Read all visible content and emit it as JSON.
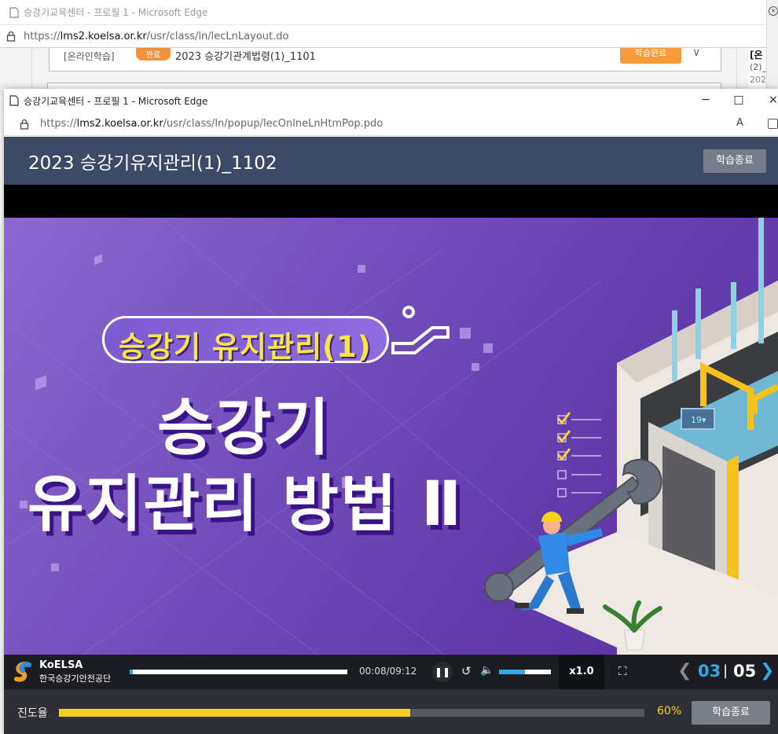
{
  "background_window": {
    "title": "승강기교육센터 - 프로필 1 - Microsoft Edge",
    "url_prefix": "https://",
    "url_host": "lms2.koelsa.or.kr",
    "url_path": "/usr/class/ln/lecLnLayout.do",
    "row": {
      "category": "[온라인학습]",
      "badge": "완료",
      "course": "2023 승강기관계법령(1)_1101",
      "button": "학습완료"
    },
    "side": {
      "line1": "[온",
      "line2": "(2)_",
      "line3": "202"
    }
  },
  "popup": {
    "title": "승강기교육센터 - 프로필 1 - Microsoft Edge",
    "url_prefix": "https://",
    "url_host": "lms2.koelsa.or.kr",
    "url_path": "/usr/class/ln/popup/lecOnlneLnHtmPop.pdo",
    "reader_label": "A",
    "lecture_title": "2023 승강기유지관리(1)_1102",
    "end_button": "학습종료"
  },
  "video": {
    "pill_title": "승강기 유지관리(1)",
    "headline_1": "승강기",
    "headline_2": "유지관리 방법 Ⅱ"
  },
  "controls": {
    "brand_en": "KoELSA",
    "brand_ko": "한국승강기안전공단",
    "time": "00:08/09:12",
    "seek_fraction": 0.014,
    "volume_fraction": 0.5,
    "speed": "x1.0",
    "current_page": "03",
    "separator": "|",
    "total_pages": "05"
  },
  "progress": {
    "label": "진도율",
    "percent_text": "60%",
    "percent": 60,
    "end_button": "학습종료"
  },
  "colors": {
    "header_bg": "#3d4a66",
    "accent_blue": "#2fa8e6",
    "progress_yellow": "#f2d21c",
    "orange": "#f89a3a"
  }
}
